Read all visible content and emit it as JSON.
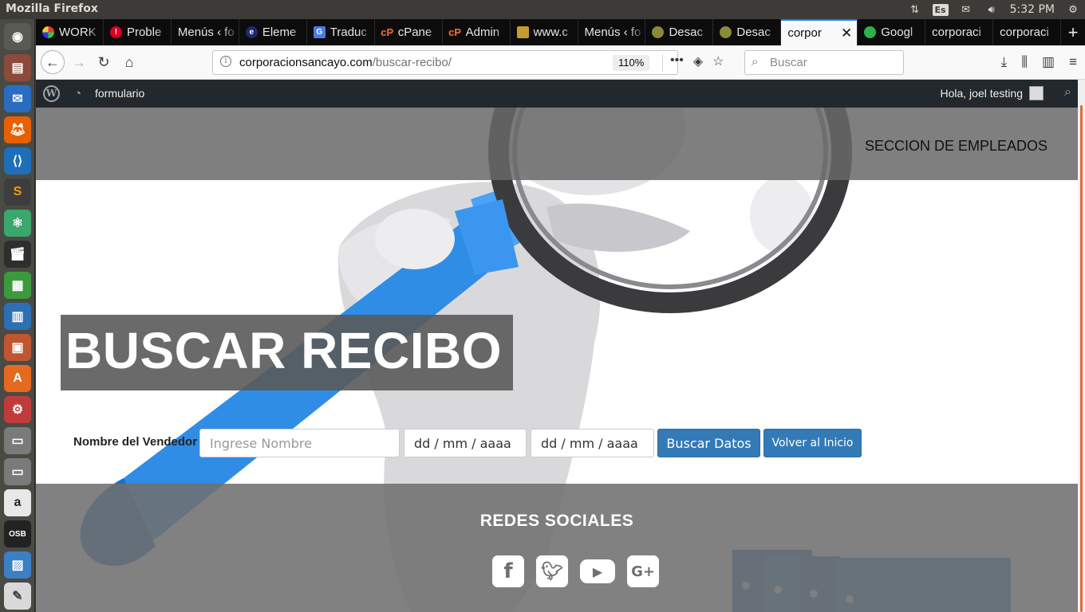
{
  "os": {
    "app_title": "Mozilla Firefox",
    "keyboard_layout": "Es",
    "clock": "5:32 PM"
  },
  "tabs": [
    {
      "label": "WORK",
      "favicon_color": "#7b3fbf"
    },
    {
      "label": "Proble",
      "favicon_color": "#d70022"
    },
    {
      "label": "Menús ‹ fo",
      "favicon_color": ""
    },
    {
      "label": "Eleme",
      "favicon_color": "#1a2b6d"
    },
    {
      "label": "Traduc",
      "favicon_color": "#4a7be3"
    },
    {
      "label": "cPane",
      "favicon_color": "#ff6c2c"
    },
    {
      "label": "Admin",
      "favicon_color": "#ff6c2c"
    },
    {
      "label": "www.c",
      "favicon_color": "#c79a2f"
    },
    {
      "label": "Menús ‹ fo",
      "favicon_color": ""
    },
    {
      "label": "Desac",
      "favicon_color": "#8a8a3a"
    },
    {
      "label": "Desac",
      "favicon_color": "#8a8a3a"
    },
    {
      "label": "corpor",
      "favicon_color": "",
      "active": true
    },
    {
      "label": "Googl",
      "favicon_color": "#2fb24c"
    },
    {
      "label": "corporaci",
      "favicon_color": ""
    },
    {
      "label": "corporaci",
      "favicon_color": ""
    }
  ],
  "navbar": {
    "url_host": "corporacionsancayo.com",
    "url_path": "/buscar-recibo/",
    "zoom": "110%",
    "search_placeholder": "Buscar"
  },
  "adminbar": {
    "site_name": "formulario",
    "howdy": "Hola, joel testing"
  },
  "page": {
    "employees_link": "SECCION DE EMPLEADOS",
    "hero_title": "BUSCAR RECIBO",
    "form": {
      "label": "Nombre del Vendedor",
      "name_placeholder": "Ingrese Nombre",
      "date_from": "dd / mm / aaaa",
      "date_to": "dd / mm / aaaa",
      "search_button": "Buscar Datos",
      "home_button": "Volver al Inicio"
    },
    "footer": {
      "social_title": "REDES SOCIALES",
      "icons": [
        "facebook-icon",
        "twitter-icon",
        "youtube-icon",
        "google-plus-icon"
      ]
    }
  },
  "colors": {
    "accent": "#337ab7",
    "firefox_tab_highlight": "#0a84ff",
    "wp_adminbar": "#23282d"
  }
}
